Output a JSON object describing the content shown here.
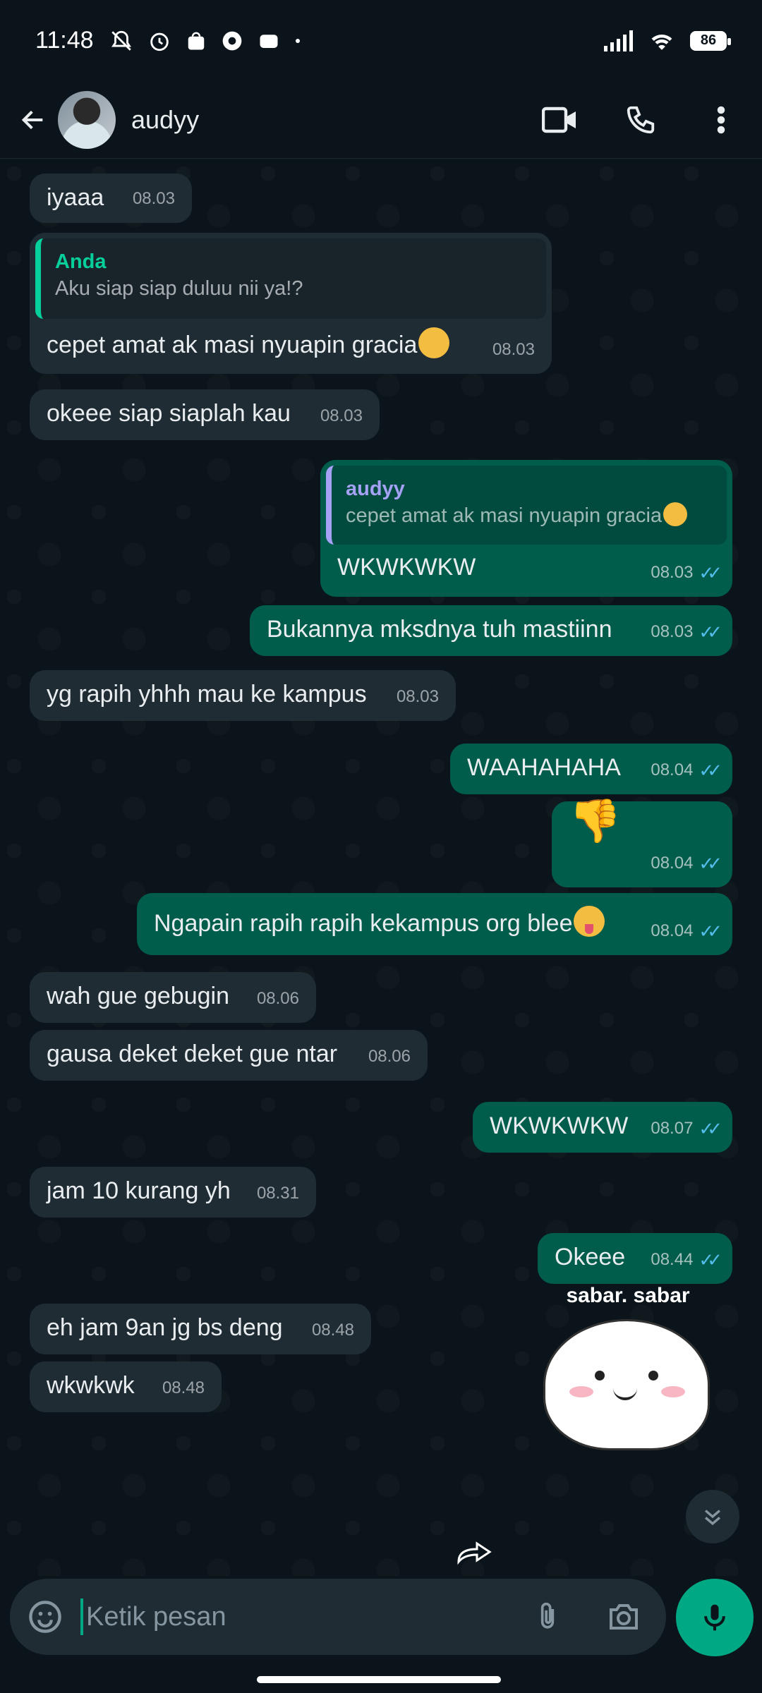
{
  "status_bar": {
    "time": "11:48",
    "battery": "86"
  },
  "header": {
    "contact_name": "audyy"
  },
  "messages": [
    {
      "dir": "in",
      "text": "iyaaa",
      "time": "08.03"
    },
    {
      "dir": "in",
      "quote_name": "Anda",
      "quote_text": "Aku siap siap duluu nii ya!?",
      "text": "cepet amat ak masi nyuapin gracia",
      "time": "08.03"
    },
    {
      "dir": "in",
      "text": "okeee siap siaplah kau",
      "time": "08.03"
    },
    {
      "dir": "out",
      "quote_name": "audyy",
      "quote_text": "cepet amat ak masi nyuapin gracia",
      "text": "WKWKWKW",
      "time": "08.03"
    },
    {
      "dir": "out",
      "text": "Bukannya mksdnya tuh mastiinn",
      "time": "08.03"
    },
    {
      "dir": "in",
      "text": "yg rapih yhhh mau ke kampus",
      "time": "08.03"
    },
    {
      "dir": "out",
      "text": "WAAHAHAHA",
      "time": "08.04"
    },
    {
      "dir": "out",
      "text": "",
      "time": "08.04"
    },
    {
      "dir": "out",
      "text": "Ngapain rapih rapih kekampus org blee",
      "time": "08.04"
    },
    {
      "dir": "in",
      "text": "wah gue gebugin",
      "time": "08.06"
    },
    {
      "dir": "in",
      "text": "gausa deket deket gue ntar",
      "time": "08.06"
    },
    {
      "dir": "out",
      "text": "WKWKWKW",
      "time": "08.07"
    },
    {
      "dir": "in",
      "text": "jam 10 kurang yh",
      "time": "08.31"
    },
    {
      "dir": "out",
      "text": "Okeee",
      "time": "08.44"
    },
    {
      "dir": "in",
      "text": "eh jam 9an jg bs deng",
      "time": "08.48"
    },
    {
      "dir": "in",
      "text": "wkwkwk",
      "time": "08.48"
    }
  ],
  "sticker": {
    "caption": "sabar. sabar"
  },
  "composer": {
    "placeholder": "Ketik pesan"
  },
  "colors": {
    "background": "#0b141a",
    "incoming_bubble": "#1f2c34",
    "outgoing_bubble": "#005c4b",
    "accent": "#00a884",
    "read_ticks": "#53bdeb"
  },
  "icons": [
    "back-arrow-icon",
    "video-call-icon",
    "phone-icon",
    "more-vert-icon",
    "sticker-icon",
    "attach-icon",
    "camera-icon",
    "mic-icon",
    "scroll-down-icon",
    "forward-icon"
  ]
}
